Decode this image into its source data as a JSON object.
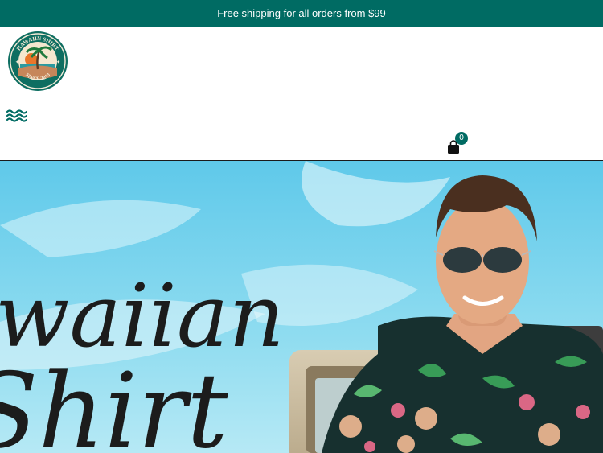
{
  "announcement": {
    "text": "Free shipping for all orders from $99"
  },
  "header": {
    "logo": {
      "top_text": "HAWAIIN SHIRT",
      "bottom_text": "SINCE 2013"
    },
    "menu_icon": "waves-menu-icon",
    "cart": {
      "icon": "shopping-bag-icon",
      "count": "0"
    }
  },
  "hero": {
    "headline_line1": "waiian",
    "headline_line2": "Shirt"
  },
  "colors": {
    "brand": "#006b63",
    "sky": "#7fd7ee",
    "text_dark": "#1b1b1b"
  }
}
